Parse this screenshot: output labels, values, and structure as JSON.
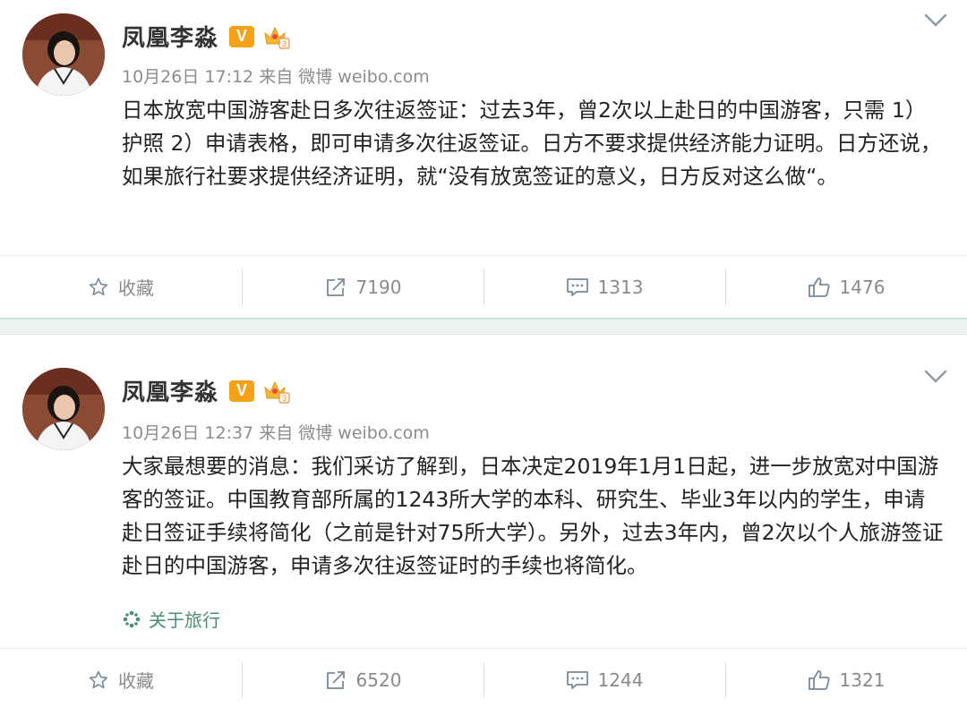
{
  "posts": [
    {
      "author": "凤凰李淼",
      "vip_badge": "V",
      "crown_level": "3",
      "time": "10月26日 17:12",
      "source": "来自 微博 weibo.com",
      "content": "日本放宽中国游客赴日多次往返签证：过去3年，曾2次以上赴日的中国游客，只需 1）护照 2）申请表格，即可申请多次往返签证。日方不要求提供经济能力证明。日方还说，如果旅行社要求提供经济证明，就“没有放宽签证的意义，日方反对这么做“。",
      "topic": "",
      "actions": {
        "favorite": "收藏",
        "repost": "7190",
        "comment": "1313",
        "like": "1476"
      }
    },
    {
      "author": "凤凰李淼",
      "vip_badge": "V",
      "crown_level": "3",
      "time": "10月26日 12:37",
      "source": "来自 微博 weibo.com",
      "content": "大家最想要的消息：我们采访了解到，日本决定2019年1月1日起，进一步放宽对中国游客的签证。中国教育部所属的1243所大学的本科、研究生、毕业3年以内的学生，申请赴日签证手续将简化（之前是针对75所大学）。另外，过去3年内，曾2次以个人旅游签证赴日的中国游客，申请多次往返签证时的手续也将简化。",
      "topic": "关于旅行",
      "actions": {
        "favorite": "收藏",
        "repost": "6520",
        "comment": "1244",
        "like": "1321"
      }
    }
  ],
  "colors": {
    "accent_topic": "#4a8f6f",
    "vip": "#f6a218",
    "separator": "#edf3f1"
  }
}
